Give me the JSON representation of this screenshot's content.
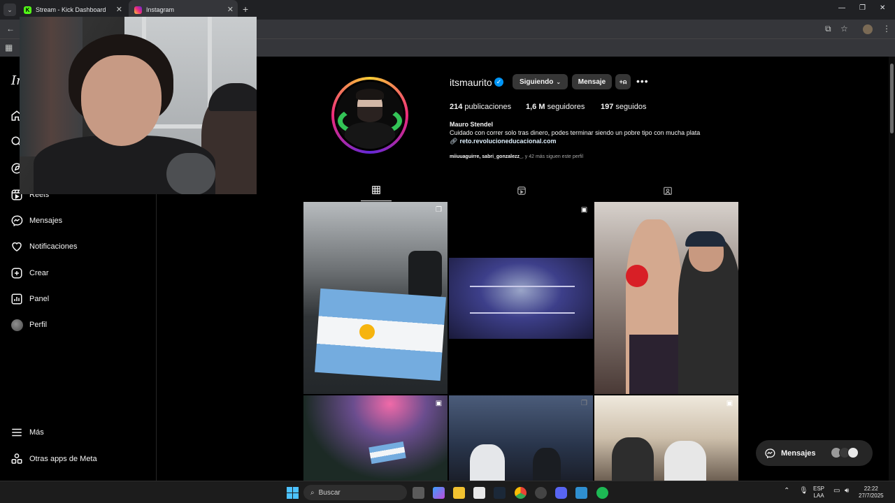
{
  "browser": {
    "tabs": [
      {
        "title": "Stream - Kick Dashboard",
        "favicon": "kick-icon"
      },
      {
        "title": "Instagram",
        "favicon": "instagram-icon",
        "active": true
      }
    ],
    "new_tab_label": "+",
    "tab_close": "✕"
  },
  "sidebar": {
    "logo": "In",
    "items": [
      {
        "label": "Reels",
        "icon": "reels-icon"
      },
      {
        "label": "Mensajes",
        "icon": "messenger-icon"
      },
      {
        "label": "Notificaciones",
        "icon": "heart-icon"
      },
      {
        "label": "Crear",
        "icon": "plus-square-icon"
      },
      {
        "label": "Panel",
        "icon": "bar-chart-icon"
      },
      {
        "label": "Perfil",
        "icon": "avatar-icon"
      }
    ],
    "bottom": [
      {
        "label": "Más",
        "icon": "menu-icon"
      },
      {
        "label": "Otras apps de Meta",
        "icon": "meta-apps-icon"
      }
    ]
  },
  "profile": {
    "username": "itsmaurito",
    "following_button": "Siguiendo",
    "message_button": "Mensaje",
    "stats": {
      "posts_value": "214",
      "posts_label": "publicaciones",
      "followers_value": "1,6 M",
      "followers_label": "seguidores",
      "following_value": "197",
      "following_label": "seguidos"
    },
    "full_name": "Mauro Stendel",
    "bio": "Cuidado con correr solo tras dinero, podes terminar siendo un pobre tipo con mucha plata",
    "link": "reto.revolucioneducacional.com",
    "followed_by_names": "miiuuaguirre, sabri_gonzalezz_",
    "followed_by_suffix": ", y 42 más siguen este perfil"
  },
  "messages_pill": {
    "label": "Mensajes"
  },
  "taskbar": {
    "search_placeholder": "Buscar",
    "lang_top": "ESP",
    "lang_bottom": "LAA",
    "time": "22:22",
    "date": "27/7/2025"
  },
  "colors": {
    "accent": "#0095f6",
    "button_bg": "#363636",
    "kick_green": "#53fc18"
  }
}
